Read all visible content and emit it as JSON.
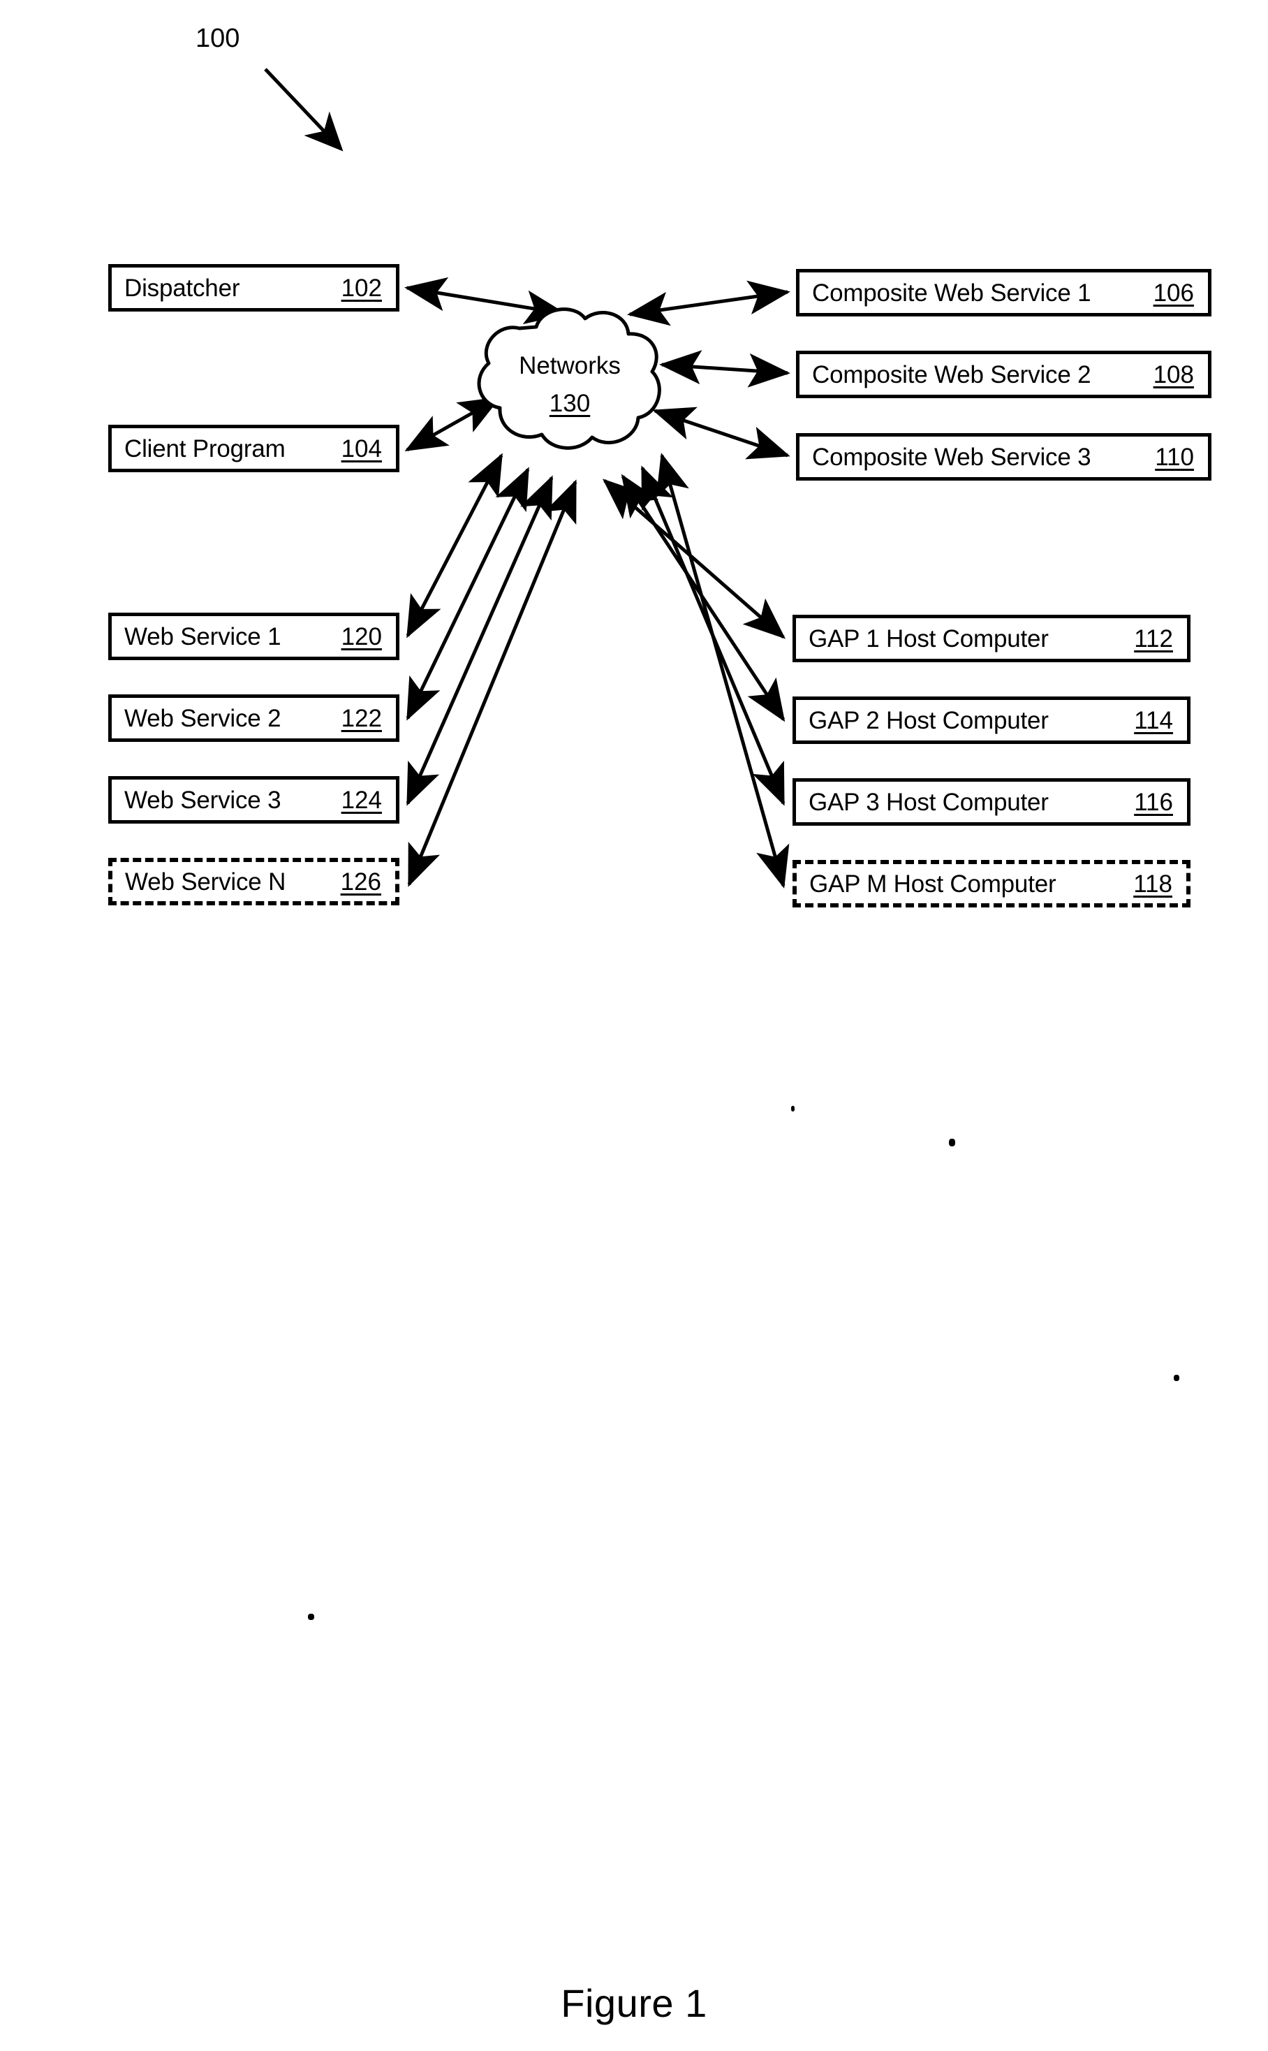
{
  "figure": {
    "callout": "100",
    "caption": "Figure 1"
  },
  "cloud": {
    "name": "cloud-networks",
    "label": "Networks",
    "ref": "130"
  },
  "left_top_boxes": [
    {
      "name": "dispatcher",
      "label": "Dispatcher",
      "ref": "102",
      "style": "solid"
    },
    {
      "name": "client-program",
      "label": "Client Program",
      "ref": "104",
      "style": "solid"
    }
  ],
  "right_top_boxes": [
    {
      "name": "composite-web-service-1",
      "label": "Composite Web Service 1",
      "ref": "106",
      "style": "solid"
    },
    {
      "name": "composite-web-service-2",
      "label": "Composite Web Service 2",
      "ref": "108",
      "style": "solid"
    },
    {
      "name": "composite-web-service-3",
      "label": "Composite Web Service 3",
      "ref": "110",
      "style": "solid"
    }
  ],
  "left_bottom_boxes": [
    {
      "name": "web-service-1",
      "label": "Web Service 1",
      "ref": "120",
      "style": "solid"
    },
    {
      "name": "web-service-2",
      "label": "Web Service 2",
      "ref": "122",
      "style": "solid"
    },
    {
      "name": "web-service-3",
      "label": "Web Service 3",
      "ref": "124",
      "style": "solid"
    },
    {
      "name": "web-service-n",
      "label": "Web Service N",
      "ref": "126",
      "style": "dashed"
    }
  ],
  "right_bottom_boxes": [
    {
      "name": "gap-1-host-computer",
      "label": "GAP 1 Host Computer",
      "ref": "112",
      "style": "solid"
    },
    {
      "name": "gap-2-host-computer",
      "label": "GAP 2 Host Computer",
      "ref": "114",
      "style": "solid"
    },
    {
      "name": "gap-3-host-computer",
      "label": "GAP 3 Host Computer",
      "ref": "116",
      "style": "solid"
    },
    {
      "name": "gap-m-host-computer",
      "label": "GAP M Host Computer",
      "ref": "118",
      "style": "dashed"
    }
  ],
  "colors": {
    "ink": "#000000",
    "paper": "#ffffff"
  }
}
